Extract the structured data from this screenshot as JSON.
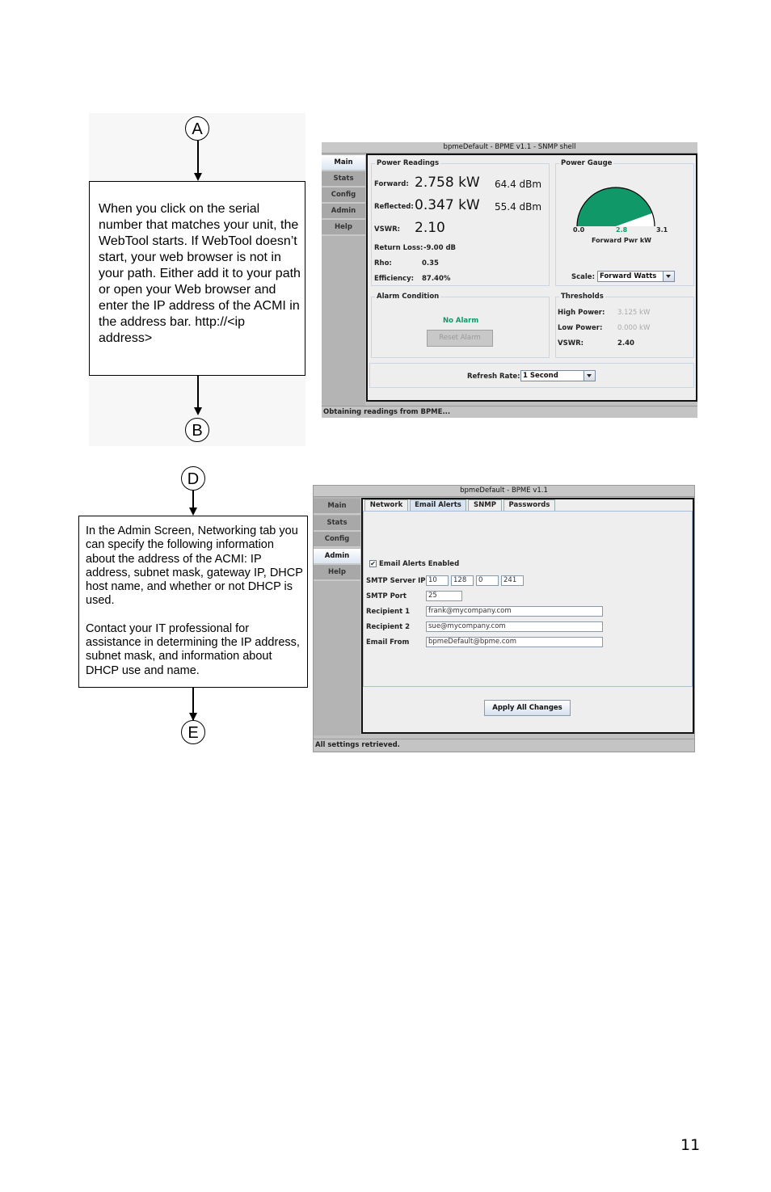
{
  "page_number": "11",
  "flow1": {
    "connector_top": "A",
    "connector_bottom": "B",
    "text": "When you click on the serial number that matches your unit, the WebTool starts.  If WebTool doesn’t start, your web browser is not in your path.  Either add it to your path or open your Web browser and enter the IP address of the ACMI in the address bar. http://<ip address>"
  },
  "flow2": {
    "connector_top": "D",
    "connector_bottom": "E",
    "paragraph1": "In the Admin Screen, Networking tab you can specify the following information about the address of the ACMI: IP address, subnet mask, gateway IP, DHCP host name, and whether or not DHCP is used.",
    "paragraph2": "Contact your IT professional for assistance in determining the IP address, subnet mask, and information about DHCP use and name."
  },
  "app1": {
    "title": "bpmeDefault - BPME v1.1 - SNMP shell",
    "sidebar": [
      "Main",
      "Stats",
      "Config",
      "Admin",
      "Help"
    ],
    "active_sidebar": "Main",
    "power_readings": {
      "title": "Power Readings",
      "forward_label": "Forward:",
      "forward_kw": "2.758 kW",
      "forward_dbm": "64.4 dBm",
      "reflected_label": "Reflected:",
      "reflected_kw": "0.347 kW",
      "reflected_dbm": "55.4 dBm",
      "vswr_label": "VSWR:",
      "vswr": "2.10",
      "return_loss_label": "Return Loss:",
      "return_loss": "-9.00 dB",
      "rho_label": "Rho:",
      "rho": "0.35",
      "efficiency_label": "Efficiency:",
      "efficiency": "87.40%"
    },
    "power_gauge": {
      "title": "Power Gauge",
      "min_label": "0.0",
      "value_label": "2.8",
      "max_label": "3.1",
      "min": 0.0,
      "value": 2.758,
      "max": 3.1,
      "caption": "Forward Pwr kW",
      "scale_label": "Scale:",
      "scale_value": "Forward Watts",
      "fill_color": "#109868"
    },
    "alarm": {
      "title": "Alarm Condition",
      "status": "No Alarm",
      "status_color": "#109868",
      "reset_label": "Reset Alarm"
    },
    "thresholds": {
      "title": "Thresholds",
      "high_power_label": "High Power:",
      "high_power": "3.125 kW",
      "low_power_label": "Low Power:",
      "low_power": "0.000 kW",
      "vswr_label": "VSWR:",
      "vswr": "2.40"
    },
    "refresh_label": "Refresh Rate:",
    "refresh_value": "1 Second",
    "status": "Obtaining readings from BPME..."
  },
  "app2": {
    "title": "bpmeDefault - BPME v1.1",
    "sidebar": [
      "Main",
      "Stats",
      "Config",
      "Admin",
      "Help"
    ],
    "active_sidebar": "Admin",
    "tabs": [
      "Network",
      "Email Alerts",
      "SNMP",
      "Passwords"
    ],
    "active_tab": "Email Alerts",
    "email_enabled_label": "Email Alerts Enabled",
    "email_enabled": true,
    "smtp_ip_label": "SMTP Server IP",
    "smtp_ip": [
      "10",
      "128",
      "0",
      "241"
    ],
    "smtp_port_label": "SMTP Port",
    "smtp_port": "25",
    "recipient1_label": "Recipient 1",
    "recipient1": "frank@mycompany.com",
    "recipient2_label": "Recipient 2",
    "recipient2": "sue@mycompany.com",
    "email_from_label": "Email From",
    "email_from": "bpmeDefault@bpme.com",
    "apply_label": "Apply All Changes",
    "status": "All settings retrieved."
  }
}
